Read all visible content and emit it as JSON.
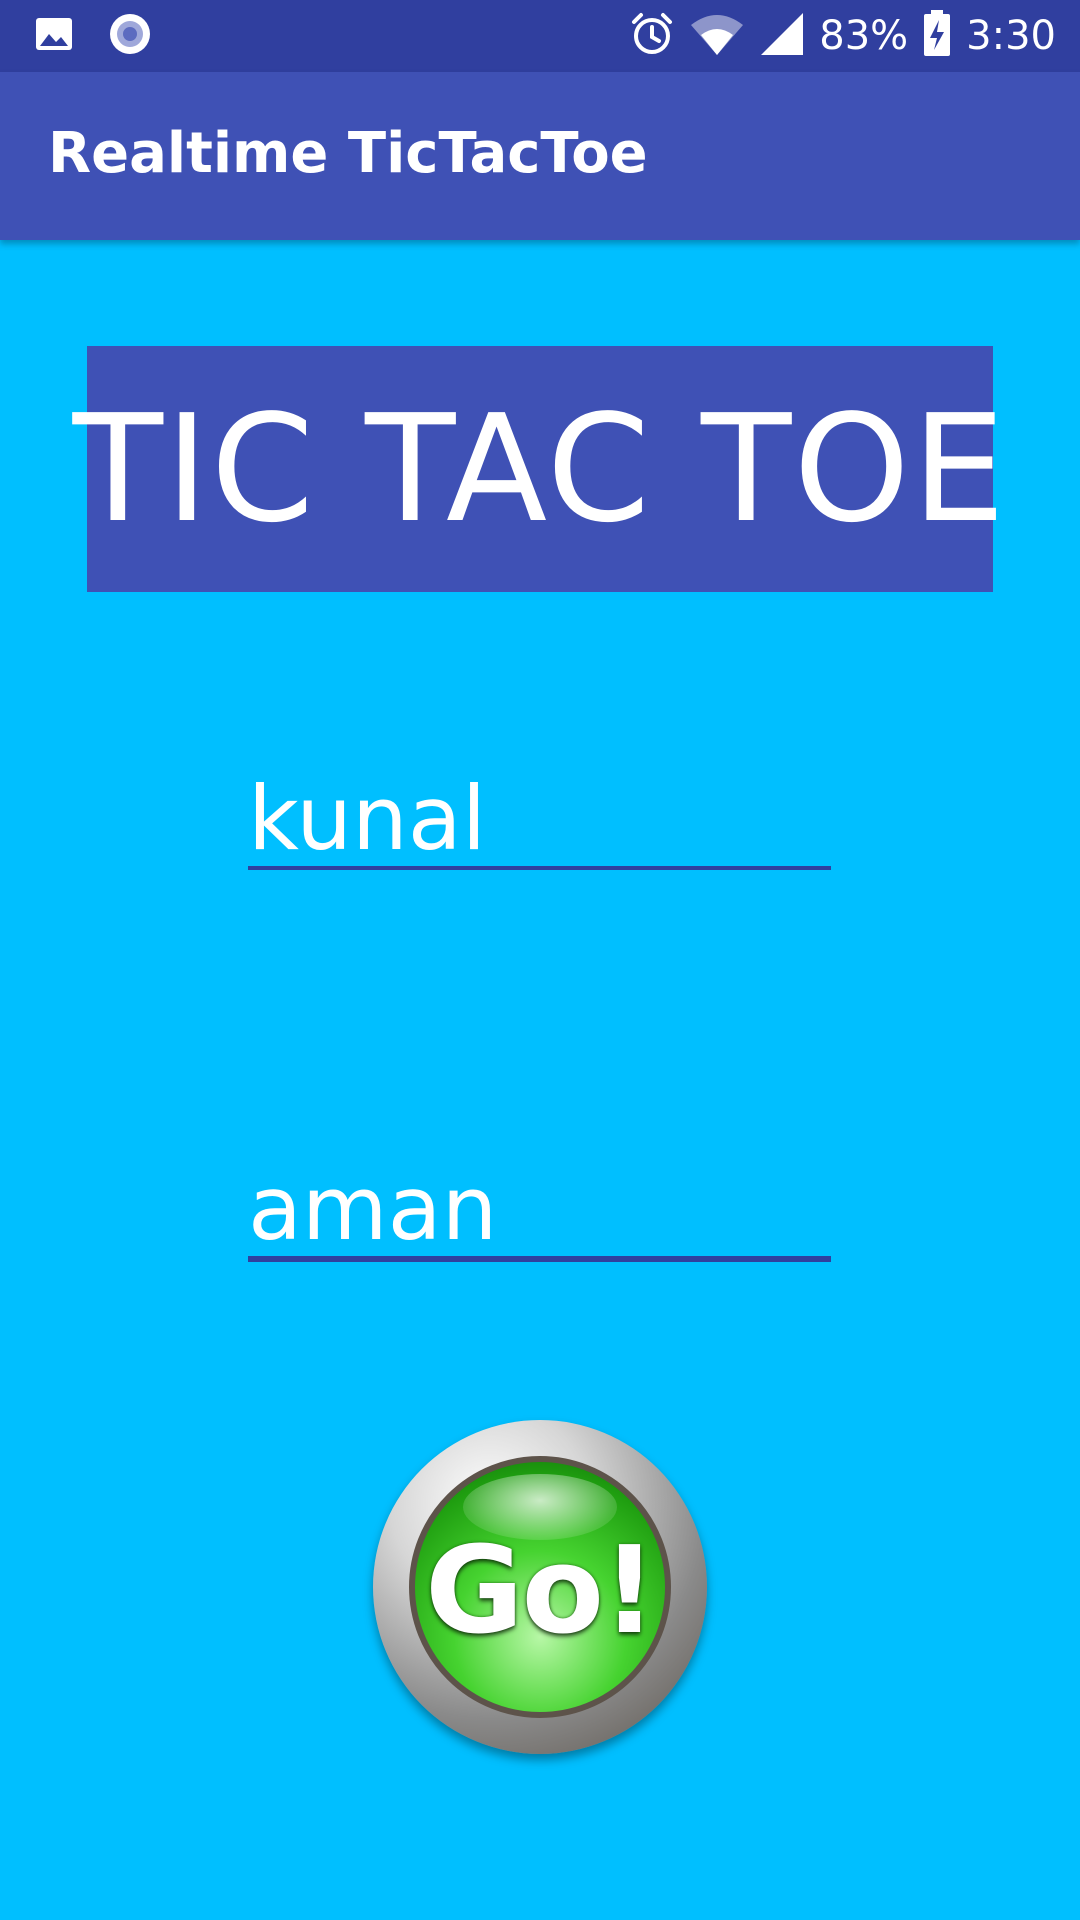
{
  "status_bar": {
    "battery": "83%",
    "time": "3:30",
    "icons": [
      "image-icon",
      "record-icon",
      "alarm-icon",
      "wifi-icon",
      "signal-icon",
      "battery-charging-icon"
    ]
  },
  "app_bar": {
    "title": "Realtime TicTacToe"
  },
  "banner": {
    "text": "TIC TAC TOE"
  },
  "player_one": {
    "value": "kunal"
  },
  "player_two": {
    "value": "aman"
  },
  "go_button": {
    "label": "Go!"
  },
  "colors": {
    "status_bar": "#303F9F",
    "app_bar": "#3F51B5",
    "background": "#00BFFF",
    "banner": "#3F51B5",
    "field_underline": "#303F9F",
    "go_green": "#2DB51A"
  }
}
